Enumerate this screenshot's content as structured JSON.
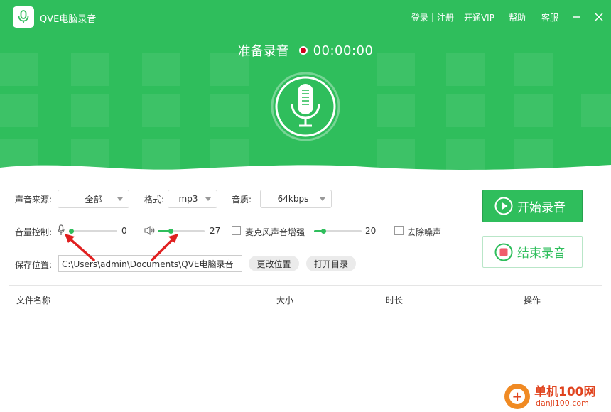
{
  "app": {
    "title": "QVE电脑录音"
  },
  "header": {
    "login": "登录",
    "sep": "|",
    "register": "注册",
    "vip": "开通VIP",
    "help": "帮助",
    "service": "客服"
  },
  "status": {
    "label": "准备录音",
    "timer": "00:00:00"
  },
  "settings": {
    "source_label": "声音来源:",
    "source_value": "全部",
    "format_label": "格式:",
    "format_value": "mp3",
    "quality_label": "音质:",
    "quality_value": "64kbps",
    "volume_label": "音量控制:",
    "mic_volume": "0",
    "speaker_volume": "27",
    "boost_label": "麦克风声音增强",
    "boost_value": "20",
    "denoise_label": "去除噪声",
    "save_label": "保存位置:",
    "save_path": "C:\\Users\\admin\\Documents\\QVE电脑录音",
    "change_location": "更改位置",
    "open_folder": "打开目录"
  },
  "sliders": {
    "mic_fraction": 0.0,
    "speaker_fraction": 0.27,
    "boost_fraction": 0.2
  },
  "actions": {
    "start": "开始录音",
    "stop": "结束录音"
  },
  "table": {
    "headers": [
      "文件名称",
      "大小",
      "时长",
      "操作"
    ]
  },
  "watermark": {
    "name": "单机100网",
    "url": "danji100.com"
  },
  "colors": {
    "brand": "#2fbe5c",
    "record_dot": "#d0021b",
    "stop_square": "#f15b6c",
    "annotation_arrow": "#e02020"
  }
}
